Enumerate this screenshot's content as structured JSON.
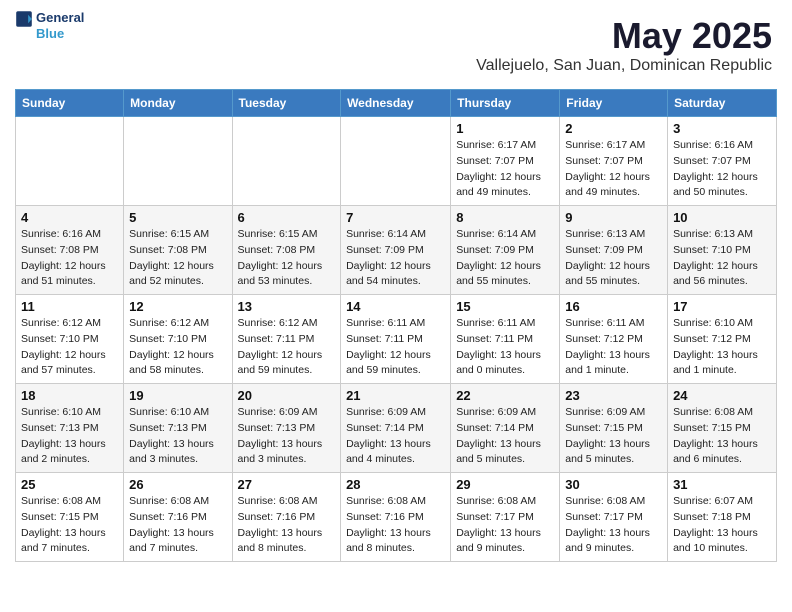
{
  "logo": {
    "line1": "General",
    "line2": "Blue"
  },
  "title": "May 2025",
  "subtitle": "Vallejuelo, San Juan, Dominican Republic",
  "weekdays": [
    "Sunday",
    "Monday",
    "Tuesday",
    "Wednesday",
    "Thursday",
    "Friday",
    "Saturday"
  ],
  "weeks": [
    [
      {
        "day": "",
        "detail": ""
      },
      {
        "day": "",
        "detail": ""
      },
      {
        "day": "",
        "detail": ""
      },
      {
        "day": "",
        "detail": ""
      },
      {
        "day": "1",
        "detail": "Sunrise: 6:17 AM\nSunset: 7:07 PM\nDaylight: 12 hours\nand 49 minutes."
      },
      {
        "day": "2",
        "detail": "Sunrise: 6:17 AM\nSunset: 7:07 PM\nDaylight: 12 hours\nand 49 minutes."
      },
      {
        "day": "3",
        "detail": "Sunrise: 6:16 AM\nSunset: 7:07 PM\nDaylight: 12 hours\nand 50 minutes."
      }
    ],
    [
      {
        "day": "4",
        "detail": "Sunrise: 6:16 AM\nSunset: 7:08 PM\nDaylight: 12 hours\nand 51 minutes."
      },
      {
        "day": "5",
        "detail": "Sunrise: 6:15 AM\nSunset: 7:08 PM\nDaylight: 12 hours\nand 52 minutes."
      },
      {
        "day": "6",
        "detail": "Sunrise: 6:15 AM\nSunset: 7:08 PM\nDaylight: 12 hours\nand 53 minutes."
      },
      {
        "day": "7",
        "detail": "Sunrise: 6:14 AM\nSunset: 7:09 PM\nDaylight: 12 hours\nand 54 minutes."
      },
      {
        "day": "8",
        "detail": "Sunrise: 6:14 AM\nSunset: 7:09 PM\nDaylight: 12 hours\nand 55 minutes."
      },
      {
        "day": "9",
        "detail": "Sunrise: 6:13 AM\nSunset: 7:09 PM\nDaylight: 12 hours\nand 55 minutes."
      },
      {
        "day": "10",
        "detail": "Sunrise: 6:13 AM\nSunset: 7:10 PM\nDaylight: 12 hours\nand 56 minutes."
      }
    ],
    [
      {
        "day": "11",
        "detail": "Sunrise: 6:12 AM\nSunset: 7:10 PM\nDaylight: 12 hours\nand 57 minutes."
      },
      {
        "day": "12",
        "detail": "Sunrise: 6:12 AM\nSunset: 7:10 PM\nDaylight: 12 hours\nand 58 minutes."
      },
      {
        "day": "13",
        "detail": "Sunrise: 6:12 AM\nSunset: 7:11 PM\nDaylight: 12 hours\nand 59 minutes."
      },
      {
        "day": "14",
        "detail": "Sunrise: 6:11 AM\nSunset: 7:11 PM\nDaylight: 12 hours\nand 59 minutes."
      },
      {
        "day": "15",
        "detail": "Sunrise: 6:11 AM\nSunset: 7:11 PM\nDaylight: 13 hours\nand 0 minutes."
      },
      {
        "day": "16",
        "detail": "Sunrise: 6:11 AM\nSunset: 7:12 PM\nDaylight: 13 hours\nand 1 minute."
      },
      {
        "day": "17",
        "detail": "Sunrise: 6:10 AM\nSunset: 7:12 PM\nDaylight: 13 hours\nand 1 minute."
      }
    ],
    [
      {
        "day": "18",
        "detail": "Sunrise: 6:10 AM\nSunset: 7:13 PM\nDaylight: 13 hours\nand 2 minutes."
      },
      {
        "day": "19",
        "detail": "Sunrise: 6:10 AM\nSunset: 7:13 PM\nDaylight: 13 hours\nand 3 minutes."
      },
      {
        "day": "20",
        "detail": "Sunrise: 6:09 AM\nSunset: 7:13 PM\nDaylight: 13 hours\nand 3 minutes."
      },
      {
        "day": "21",
        "detail": "Sunrise: 6:09 AM\nSunset: 7:14 PM\nDaylight: 13 hours\nand 4 minutes."
      },
      {
        "day": "22",
        "detail": "Sunrise: 6:09 AM\nSunset: 7:14 PM\nDaylight: 13 hours\nand 5 minutes."
      },
      {
        "day": "23",
        "detail": "Sunrise: 6:09 AM\nSunset: 7:15 PM\nDaylight: 13 hours\nand 5 minutes."
      },
      {
        "day": "24",
        "detail": "Sunrise: 6:08 AM\nSunset: 7:15 PM\nDaylight: 13 hours\nand 6 minutes."
      }
    ],
    [
      {
        "day": "25",
        "detail": "Sunrise: 6:08 AM\nSunset: 7:15 PM\nDaylight: 13 hours\nand 7 minutes."
      },
      {
        "day": "26",
        "detail": "Sunrise: 6:08 AM\nSunset: 7:16 PM\nDaylight: 13 hours\nand 7 minutes."
      },
      {
        "day": "27",
        "detail": "Sunrise: 6:08 AM\nSunset: 7:16 PM\nDaylight: 13 hours\nand 8 minutes."
      },
      {
        "day": "28",
        "detail": "Sunrise: 6:08 AM\nSunset: 7:16 PM\nDaylight: 13 hours\nand 8 minutes."
      },
      {
        "day": "29",
        "detail": "Sunrise: 6:08 AM\nSunset: 7:17 PM\nDaylight: 13 hours\nand 9 minutes."
      },
      {
        "day": "30",
        "detail": "Sunrise: 6:08 AM\nSunset: 7:17 PM\nDaylight: 13 hours\nand 9 minutes."
      },
      {
        "day": "31",
        "detail": "Sunrise: 6:07 AM\nSunset: 7:18 PM\nDaylight: 13 hours\nand 10 minutes."
      }
    ]
  ]
}
